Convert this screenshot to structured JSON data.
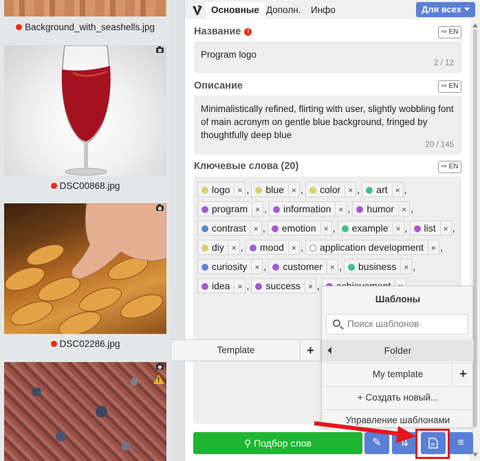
{
  "gallery": {
    "items": [
      {
        "caption": "Background_with_seashells.jpg"
      },
      {
        "caption": "DSC00868.jpg"
      },
      {
        "caption": "DSC02286.jpg"
      }
    ]
  },
  "tabs": {
    "main": "Основные",
    "extra": "Дополн.",
    "info": "Инфо",
    "for_all": "Для всех"
  },
  "title_field": {
    "label": "Название",
    "lang": "EN",
    "value": "Program logo",
    "counter": "2 / 12"
  },
  "description_field": {
    "label": "Описание",
    "lang": "EN",
    "value": "Minimalistically refined, flirting with user, slightly wobbling font of main acronym on gentle blue background, fringed by thoughtfully deep blue",
    "counter": "20 / 145"
  },
  "keywords": {
    "label": "Ключевые слова (20)",
    "lang": "EN",
    "rows": [
      [
        {
          "t": "logo",
          "c": "#d3d36b"
        },
        {
          "t": "blue",
          "c": "#d3d36b"
        },
        {
          "t": "color",
          "c": "#d3d36b"
        },
        {
          "t": "art",
          "c": "#3fbf8a"
        }
      ],
      [
        {
          "t": "program",
          "c": "#a25bd1"
        },
        {
          "t": "information",
          "c": "#a25bd1"
        },
        {
          "t": "humor",
          "c": "#a25bd1"
        }
      ],
      [
        {
          "t": "contrast",
          "c": "#5b86d9"
        },
        {
          "t": "emotion",
          "c": "#a25bd1"
        },
        {
          "t": "example",
          "c": "#3fbf8a"
        },
        {
          "t": "list",
          "c": "#a25bd1"
        }
      ],
      [
        {
          "t": "diy",
          "c": "#d3d36b"
        },
        {
          "t": "mood",
          "c": "#a25bd1"
        },
        {
          "t": "application development",
          "c": "#ffffff"
        }
      ],
      [
        {
          "t": "curiosity",
          "c": "#5b86d9"
        },
        {
          "t": "customer",
          "c": "#a25bd1"
        },
        {
          "t": "business",
          "c": "#3fbf8a"
        }
      ],
      [
        {
          "t": "idea",
          "c": "#a25bd1"
        },
        {
          "t": "success",
          "c": "#a25bd1"
        },
        {
          "t": "achievement",
          "c": "#a25bd1"
        }
      ]
    ]
  },
  "templates": {
    "title": "Шаблоны",
    "search_placeholder": "Поиск шаблонов",
    "folder": "Folder",
    "item": "My template",
    "create": "+ Создать новый...",
    "manage": "Управление шаблонами",
    "side_item": "Template"
  },
  "toolbar": {
    "pick_words": "Подбор слов"
  },
  "colors": {
    "accent": "#5a7fd6",
    "green": "#1fb532",
    "highlight": "#e3161b"
  }
}
